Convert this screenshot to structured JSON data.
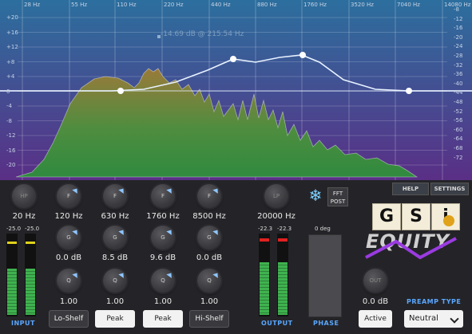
{
  "analyzer": {
    "freq_labels": [
      "28 Hz",
      "55 Hz",
      "110 Hz",
      "220 Hz",
      "440 Hz",
      "880 Hz",
      "1760 Hz",
      "3520 Hz",
      "7040 Hz",
      "14080 Hz"
    ],
    "left_db_labels": [
      "+20",
      "+16",
      "+12",
      "+8",
      "+4",
      "0",
      "-4",
      "-8",
      "-12",
      "-16",
      "-20"
    ],
    "right_db_labels": [
      "-8",
      "-12",
      "-16",
      "-20",
      "-24",
      "-28",
      "-32",
      "-36",
      "-40",
      "-44",
      "-48",
      "-52",
      "-56",
      "-60",
      "-64",
      "-68",
      "-72"
    ],
    "readout": "-14.69 dB @ 215.54 Hz",
    "colors": {
      "bg_top": "#2c6f9e",
      "bg_bottom": "#5a2f86",
      "spectrum_top": "#9a7a3a",
      "spectrum_bottom": "#2f8a3f",
      "curve": "#e8f2ff"
    }
  },
  "fft": {
    "label_line1": "FFT",
    "label_line2": "POST"
  },
  "snowflake_icon": "snowflake-icon",
  "header_buttons": {
    "help": "HELP",
    "settings": "SETTINGS"
  },
  "bands": [
    {
      "id": "hp",
      "knob_label": "HP",
      "freq": "20 Hz"
    },
    {
      "id": "b1",
      "knob_label": "F",
      "freq": "120 Hz",
      "gain_label": "G",
      "gain": "0.0 dB",
      "q_label": "Q",
      "q": "1.00",
      "type": "Lo-Shelf"
    },
    {
      "id": "b2",
      "knob_label": "F",
      "freq": "630 Hz",
      "gain_label": "G",
      "gain": "8.5 dB",
      "q_label": "Q",
      "q": "1.00",
      "type": "Peak"
    },
    {
      "id": "b3",
      "knob_label": "F",
      "freq": "1760 Hz",
      "gain_label": "G",
      "gain": "9.6 dB",
      "q_label": "Q",
      "q": "1.00",
      "type": "Peak"
    },
    {
      "id": "b4",
      "knob_label": "F",
      "freq": "8500 Hz",
      "gain_label": "G",
      "gain": "0.0 dB",
      "q_label": "Q",
      "q": "1.00",
      "type": "Hi-Shelf"
    },
    {
      "id": "lp",
      "knob_label": "LP",
      "freq": "20000 Hz"
    }
  ],
  "input": {
    "label": "INPUT",
    "left": "-25.0",
    "right": "-25.0"
  },
  "output": {
    "label": "OUTPUT",
    "left": "-22.3",
    "right": "-22.3"
  },
  "phase": {
    "label": "PHASE",
    "value": "0 deg"
  },
  "out_knob": {
    "label": "OUT",
    "value": "0.0 dB",
    "button": "Active"
  },
  "logo": {
    "tiles": [
      "G",
      "S",
      "i"
    ],
    "name": "EQUITY"
  },
  "preamp": {
    "label": "PREAMP TYPE",
    "value": "Neutral"
  }
}
